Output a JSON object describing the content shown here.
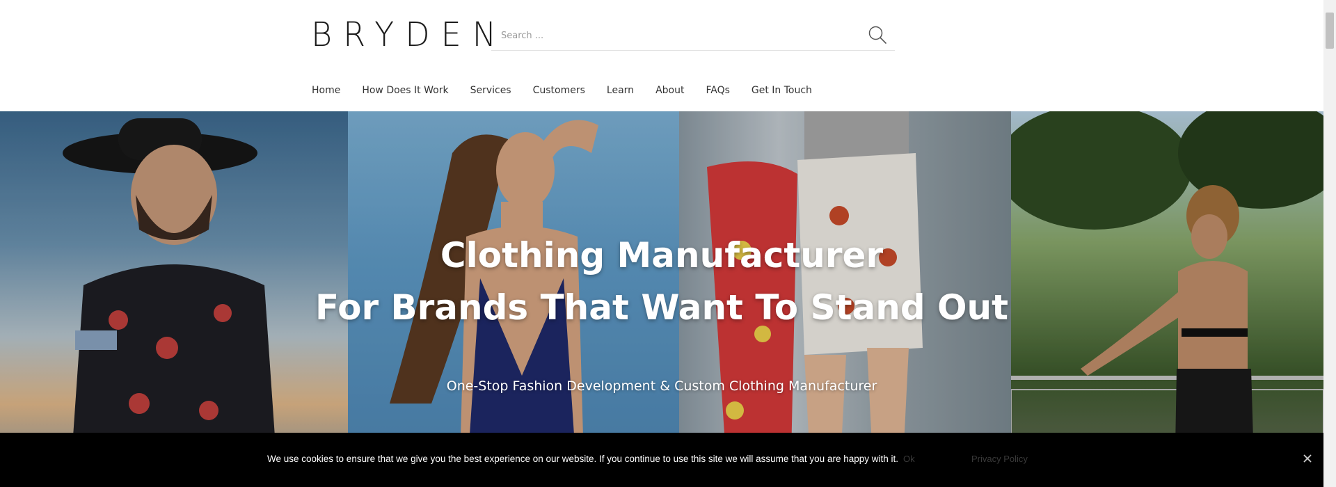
{
  "header": {
    "logo_text": "BRYDEN",
    "search": {
      "placeholder": "Search ...",
      "value": ""
    },
    "search_icon": "search-icon",
    "nav": [
      "Home",
      "How Does It Work",
      "Services",
      "Customers",
      "Learn",
      "About",
      "FAQs",
      "Get In Touch"
    ]
  },
  "hero": {
    "title_line1": "Clothing Manufacturer",
    "title_line2": "For Brands That Want To Stand Out",
    "subtitle": "One-Stop Fashion Development & Custom Clothing Manufacturer"
  },
  "cookie_bar": {
    "message": "We use cookies to ensure that we give you the best experience on our website. If you continue to use this site we will assume that you are happy with it.",
    "ok_label": "Ok",
    "policy_label": "Privacy Policy",
    "close_icon": "close-icon"
  },
  "colors": {
    "header_bg": "#ffffff",
    "cookie_bg": "#000000",
    "hero_text": "#ffffff",
    "cookie_button_text": "#3a3a3a"
  }
}
